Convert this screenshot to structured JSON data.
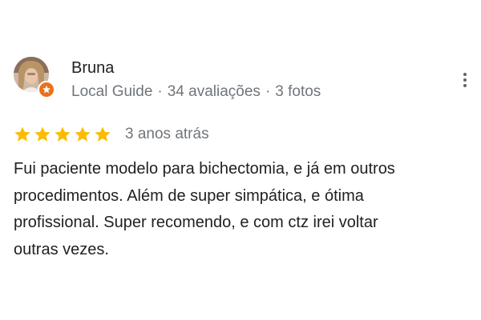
{
  "review": {
    "author": {
      "name": "Bruna",
      "avatar_icon": "user-photo-avatar",
      "badge_icon": "local-guide-badge-icon",
      "badge_color": "#e8711c",
      "level": "Local Guide",
      "reviews_count": "34 avaliações",
      "photos_count": "3 fotos",
      "separator": "·"
    },
    "menu_icon": "more-vert-icon",
    "rating": {
      "stars": 5,
      "max_stars": 5,
      "star_color": "#fbbc04",
      "time_ago": "3 anos atrás"
    },
    "text_lines": [
      "Fui paciente modelo para bichectomia, e já em outros",
      "procedimentos. Além de super simpática, e ótima",
      "profissional. Super recomendo, e com ctz irei voltar",
      "outras vezes."
    ]
  }
}
